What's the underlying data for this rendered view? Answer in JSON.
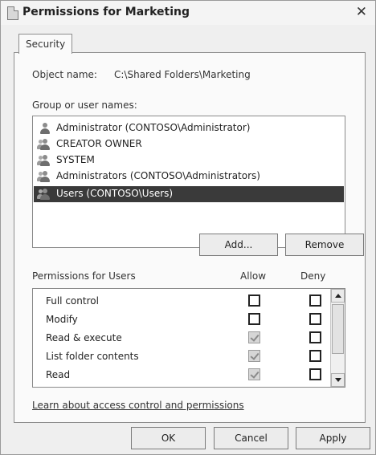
{
  "window": {
    "title": "Permissions for Marketing",
    "close_glyph": "✕"
  },
  "tabs": [
    {
      "label": "Security"
    }
  ],
  "object": {
    "label": "Object name:",
    "value": "C:\\Shared Folders\\Marketing"
  },
  "group_label": "Group or user names:",
  "users": [
    {
      "name": "Administrator (CONTOSO\\Administrator)",
      "icon": "user-icon"
    },
    {
      "name": "CREATOR OWNER",
      "icon": "group-icon"
    },
    {
      "name": "SYSTEM",
      "icon": "group-icon"
    },
    {
      "name": "Administrators (CONTOSO\\Administrators)",
      "icon": "group-icon"
    },
    {
      "name": "Users (CONTOSO\\Users)",
      "icon": "group-icon",
      "selected": true
    }
  ],
  "buttons": {
    "add": "Add...",
    "remove": "Remove",
    "ok": "OK",
    "cancel": "Cancel",
    "apply": "Apply"
  },
  "permissions": {
    "header": "Permissions for Users",
    "allow_label": "Allow",
    "deny_label": "Deny",
    "rows": [
      {
        "label": "Full control",
        "allow": false,
        "deny": false
      },
      {
        "label": "Modify",
        "allow": false,
        "deny": false
      },
      {
        "label": "Read & execute",
        "allow": "inherited",
        "deny": false
      },
      {
        "label": "List folder contents",
        "allow": "inherited",
        "deny": false
      },
      {
        "label": "Read",
        "allow": "inherited",
        "deny": false
      }
    ]
  },
  "learn_link": "Learn about access control and permissions",
  "colors": {
    "selection": "#3a3a3a",
    "panel": "#fafafa",
    "chrome": "#efefef"
  }
}
